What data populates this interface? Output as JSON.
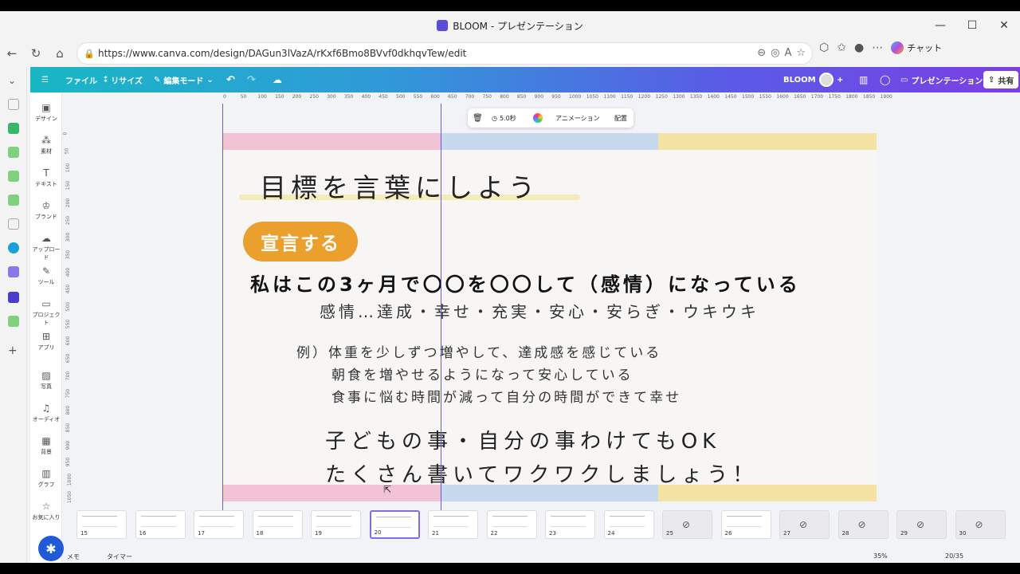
{
  "window": {
    "title": "BLOOM - プレゼンテーション",
    "controls": [
      "—",
      "☐",
      "✕"
    ]
  },
  "browser": {
    "url": "https://www.canva.com/design/DAGun3lVazA/rKxf6Bmo8BVvf0dkhqvTew/edit",
    "chat_label": "チャット"
  },
  "canva_toolbar": {
    "file": "ファイル",
    "resize": "リサイズ",
    "edit_mode": "編集モード",
    "doc_name": "BLOOM",
    "present": "プレゼンテーション",
    "share": "共有"
  },
  "left_panel": [
    {
      "label": "デザイン",
      "icon": "▣"
    },
    {
      "label": "素材",
      "icon": "⁂"
    },
    {
      "label": "テキスト",
      "icon": "T"
    },
    {
      "label": "ブランド",
      "icon": "♔"
    },
    {
      "label": "アップロード",
      "icon": "☁"
    },
    {
      "label": "ツール",
      "icon": "✎"
    },
    {
      "label": "プロジェクト",
      "icon": "▭"
    },
    {
      "label": "アプリ",
      "icon": "⊞"
    },
    {
      "label": "写真",
      "icon": "▨"
    },
    {
      "label": "オーディオ",
      "icon": "♫"
    },
    {
      "label": "背景",
      "icon": "▦"
    },
    {
      "label": "グラフ",
      "icon": "▥"
    },
    {
      "label": "お気に入り",
      "icon": "☆"
    }
  ],
  "ruler": [
    "0",
    "50",
    "100",
    "150",
    "200",
    "250",
    "300",
    "350",
    "400",
    "450",
    "500",
    "550",
    "600",
    "650",
    "700",
    "750",
    "800",
    "850",
    "900",
    "950",
    "1000",
    "1050",
    "1100",
    "1150",
    "1200",
    "1250",
    "1300",
    "1350",
    "1400",
    "1450",
    "1500",
    "1550",
    "1600",
    "1650",
    "1700",
    "1750",
    "1800",
    "1850",
    "1900"
  ],
  "vruler": [
    "0",
    "50",
    "100",
    "150",
    "200",
    "250",
    "300",
    "350",
    "400",
    "450",
    "500",
    "550",
    "600",
    "650",
    "700",
    "750",
    "800",
    "850",
    "900",
    "950",
    "1000",
    "1050"
  ],
  "float_toolbar": {
    "duration": "5.0秒",
    "animation": "アニメーション",
    "arrange": "配置"
  },
  "slide": {
    "title": "目標を言葉にしよう",
    "pill": "宣言する",
    "main": "私はこの3ヶ月で〇〇を〇〇して（感情）になっている",
    "emotions": "感情…達成・幸せ・充実・安心・安らぎ・ウキウキ",
    "example1": "例）体重を少しずつ増やして、達成感を感じている",
    "example2": "朝食を増やせるようになって安心している",
    "example3": "食事に悩む時間が減って自分の時間ができて幸せ",
    "big1": "子どもの事・自分の事わけてもOK",
    "big2": "たくさん書いてワクワクしましょう！",
    "colors": {
      "pink": "#f2c3d4",
      "blue": "#c6d9ee",
      "yellow": "#f4e3a5",
      "pill": "#eb9f2c"
    }
  },
  "thumbnails": [
    {
      "num": "15",
      "hidden": false
    },
    {
      "num": "16",
      "hidden": false
    },
    {
      "num": "17",
      "hidden": false
    },
    {
      "num": "18",
      "hidden": false
    },
    {
      "num": "19",
      "hidden": false
    },
    {
      "num": "20",
      "hidden": false,
      "active": true
    },
    {
      "num": "21",
      "hidden": false
    },
    {
      "num": "22",
      "hidden": false
    },
    {
      "num": "23",
      "hidden": false
    },
    {
      "num": "24",
      "hidden": false
    },
    {
      "num": "25",
      "hidden": true
    },
    {
      "num": "26",
      "hidden": false
    },
    {
      "num": "27",
      "hidden": true
    },
    {
      "num": "28",
      "hidden": true
    },
    {
      "num": "29",
      "hidden": true
    },
    {
      "num": "30",
      "hidden": true
    }
  ],
  "bottom": {
    "notes": "メモ",
    "timer": "タイマー",
    "zoom": "35%",
    "page": "20/35"
  }
}
